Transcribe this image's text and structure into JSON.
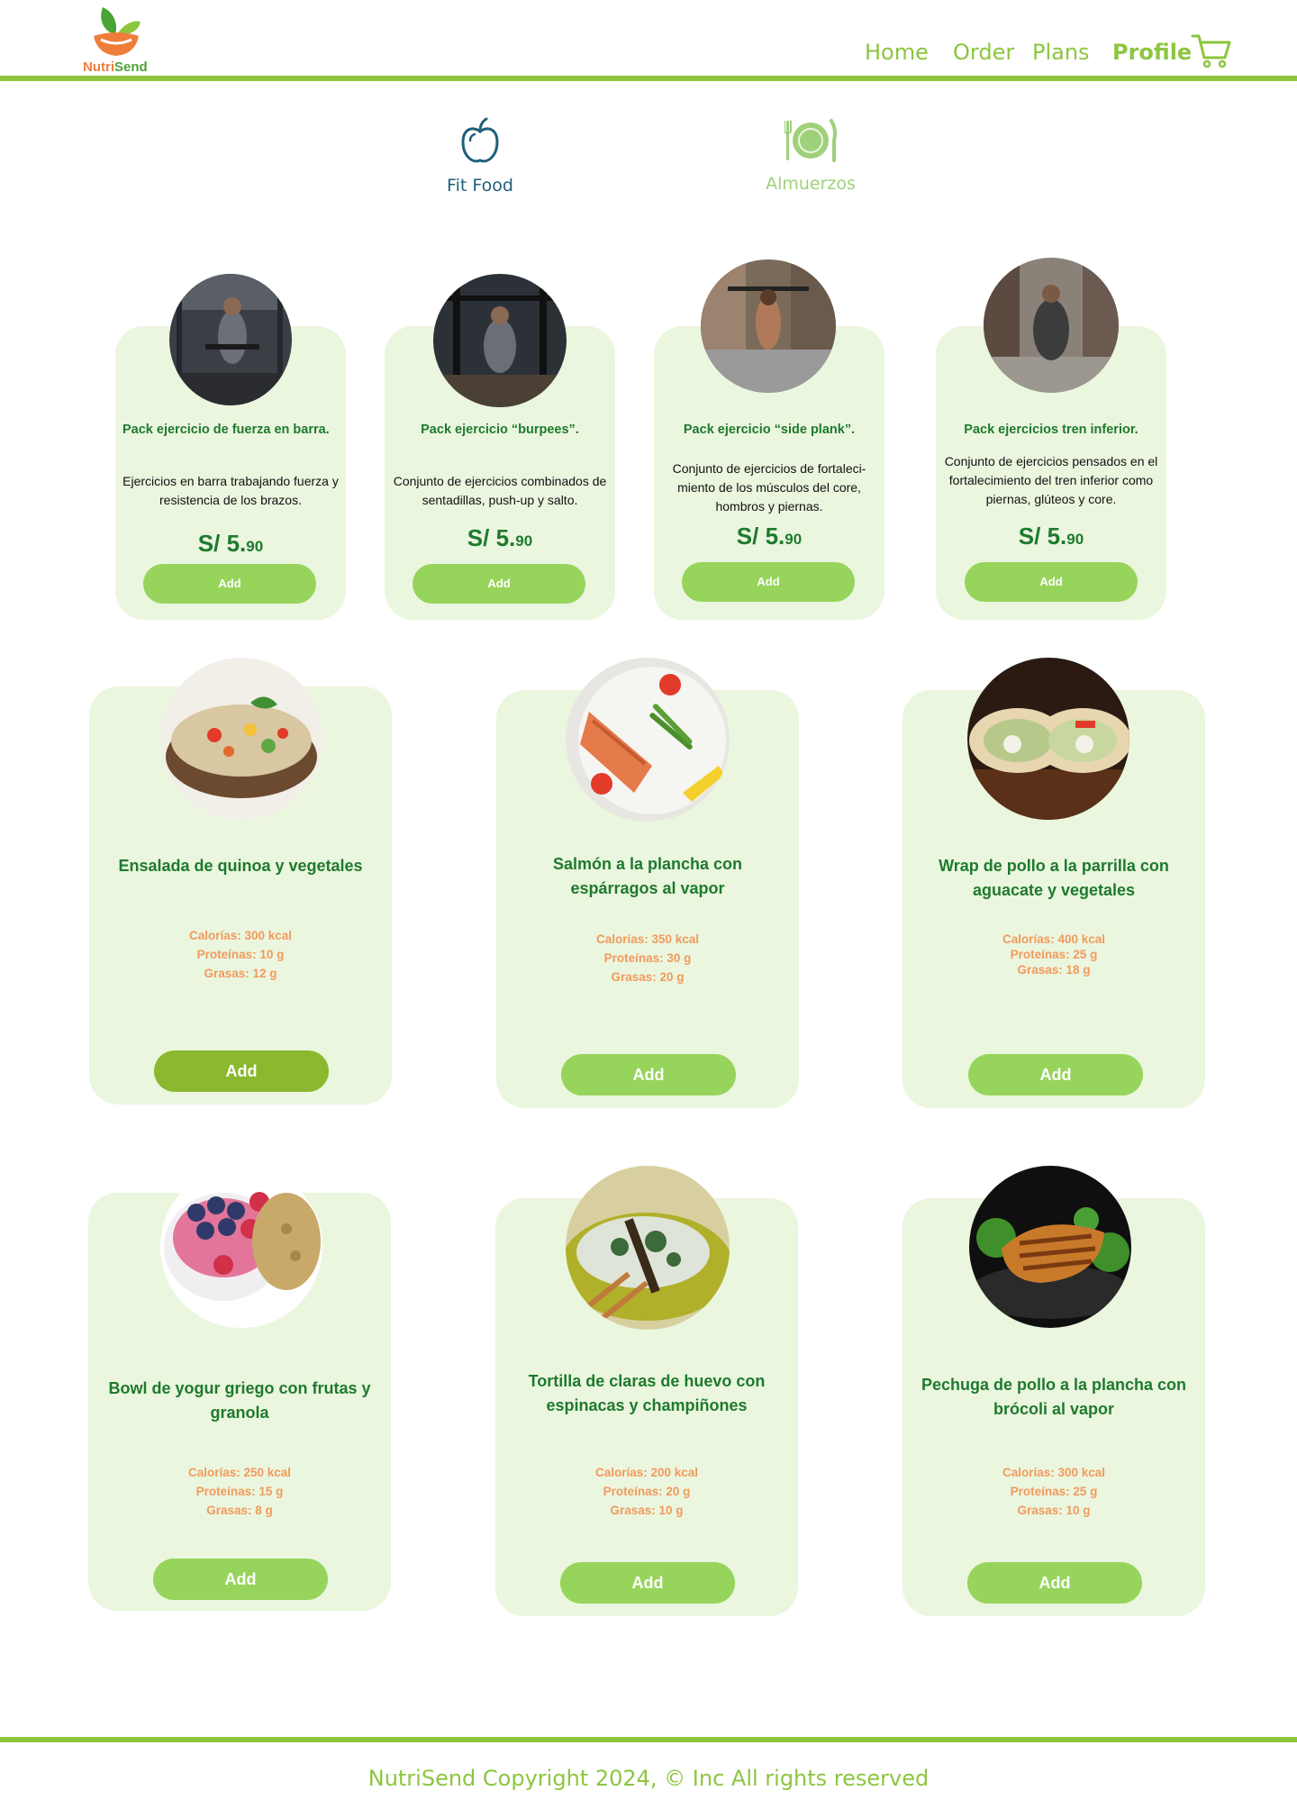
{
  "brand": {
    "name_part1": "Nutri",
    "name_part2": "Send"
  },
  "nav": {
    "home": "Home",
    "order": "Order",
    "plans": "Plans",
    "profile": "Profile",
    "cart_icon": "cart-icon"
  },
  "categories": [
    {
      "label": "Fit Food",
      "icon": "apple-icon",
      "active": true
    },
    {
      "label": "Almuerzos",
      "icon": "plate-icon",
      "active": false
    }
  ],
  "packs": [
    {
      "title": "Pack ejercicio de fuerza en barra.",
      "description": "Ejercicios en barra trabajando fuerza y resistencia de los brazos.",
      "price_main": "S/ 5.",
      "price_cents": "90",
      "button": "Add"
    },
    {
      "title": "Pack ejercicio “burpees”.",
      "description": "Conjunto de ejercicios combinados de sentadillas, push-up y salto.",
      "price_main": "S/ 5.",
      "price_cents": "90",
      "button": "Add"
    },
    {
      "title": "Pack ejercicio “side plank”.",
      "description": "Conjunto de ejercicios de fortaleci-miento de los músculos del core, hombros y piernas.",
      "price_main": "S/ 5.",
      "price_cents": "90",
      "button": "Add"
    },
    {
      "title": "Pack ejercicios tren inferior.",
      "description": "Conjunto de ejercicios pensados en el fortalecimiento del tren inferior como piernas, glúteos y core.",
      "price_main": "S/ 5.",
      "price_cents": "90",
      "button": "Add"
    }
  ],
  "foods": [
    {
      "title": "Ensalada de quinoa y vegetales",
      "calorias": "Calorías: 300 kcal",
      "proteinas": "Proteínas: 10 g",
      "grasas": "Grasas: 12 g",
      "button": "Add"
    },
    {
      "title": "Salmón a la plancha con espárragos al vapor",
      "calorias": "Calorías: 350 kcal",
      "proteinas": "Proteínas: 30 g",
      "grasas": "Grasas: 20 g",
      "button": "Add"
    },
    {
      "title": "Wrap de pollo a la parrilla con aguacate y vegetales",
      "calorias": "Calorías: 400 kcal",
      "proteinas": "Proteínas: 25 g",
      "grasas": "Grasas: 18 g",
      "button": "Add"
    },
    {
      "title": "Bowl de yogur griego con frutas y granola",
      "calorias": "Calorías: 250 kcal",
      "proteinas": "Proteínas: 15 g",
      "grasas": "Grasas: 8 g",
      "button": "Add"
    },
    {
      "title": "Tortilla de claras de huevo con espinacas y champiñones",
      "calorias": "Calorías: 200 kcal",
      "proteinas": "Proteínas: 20 g",
      "grasas": "Grasas: 10 g",
      "button": "Add"
    },
    {
      "title": "Pechuga de pollo a la plancha con brócoli al vapor",
      "calorias": "Calorías: 300 kcal",
      "proteinas": "Proteínas: 25 g",
      "grasas": "Grasas: 10 g",
      "button": "Add"
    }
  ],
  "footer": {
    "text": "NutriSend Copyright 2024, © Inc All rights reserved"
  },
  "colors": {
    "accent": "#8cc63f",
    "card_bg": "#ebf6df",
    "button": "#97d45c",
    "title_green": "#1e7a2e",
    "nutri_orange": "#f29a5c"
  }
}
